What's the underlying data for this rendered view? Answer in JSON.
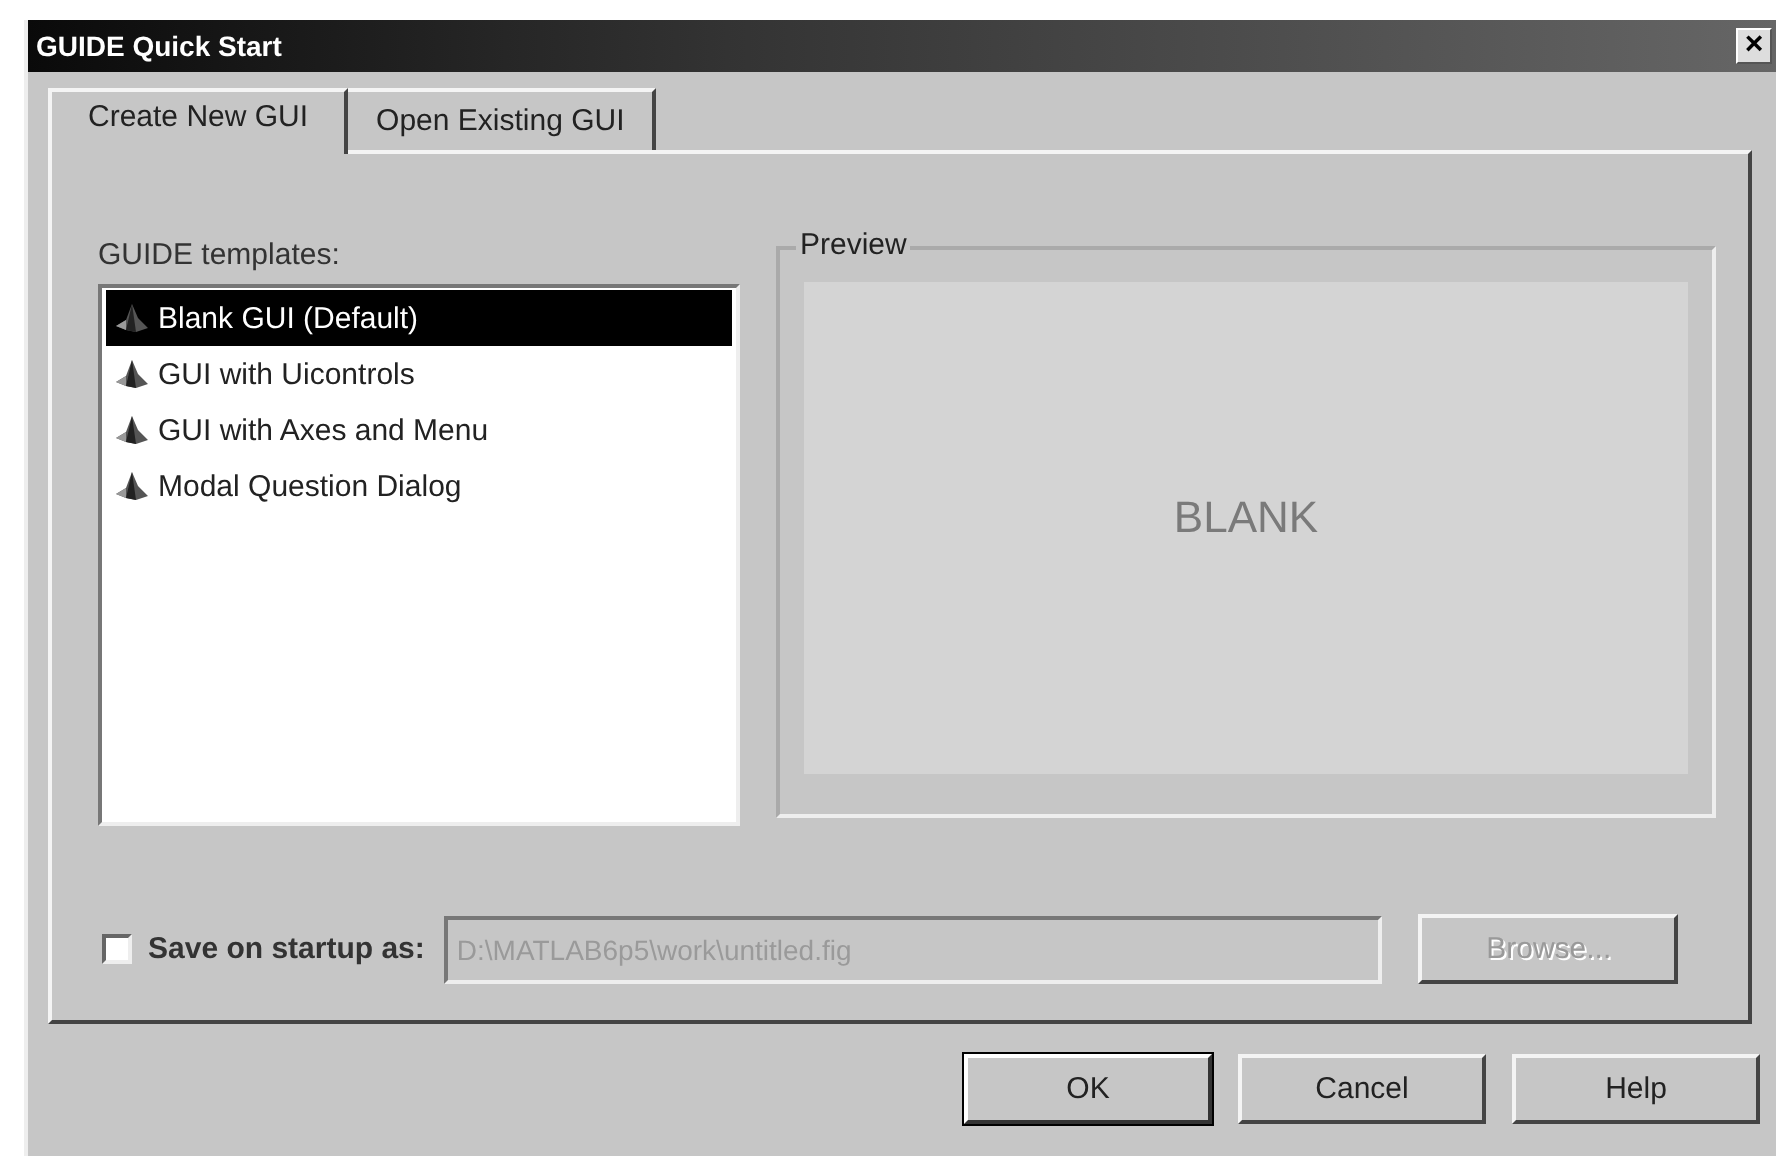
{
  "window": {
    "title": "GUIDE Quick Start",
    "close": "×"
  },
  "tabs": [
    {
      "label": "Create New GUI",
      "selected": true
    },
    {
      "label": "Open Existing GUI",
      "selected": false
    }
  ],
  "templates": {
    "label": "GUIDE templates:",
    "items": [
      {
        "label": "Blank GUI (Default)",
        "selected": true
      },
      {
        "label": "GUI with Uicontrols",
        "selected": false
      },
      {
        "label": "GUI with Axes and Menu",
        "selected": false
      },
      {
        "label": "Modal Question Dialog",
        "selected": false
      }
    ]
  },
  "preview": {
    "title": "Preview",
    "text": "BLANK"
  },
  "save": {
    "label": "Save on startup as:",
    "checked": false,
    "value": "D:\\MATLAB6p5\\work\\untitled.fig",
    "browse": "Browse...",
    "disabled": true
  },
  "buttons": [
    {
      "label": "OK",
      "default": true
    },
    {
      "label": "Cancel",
      "default": false
    },
    {
      "label": "Help",
      "default": false
    }
  ]
}
